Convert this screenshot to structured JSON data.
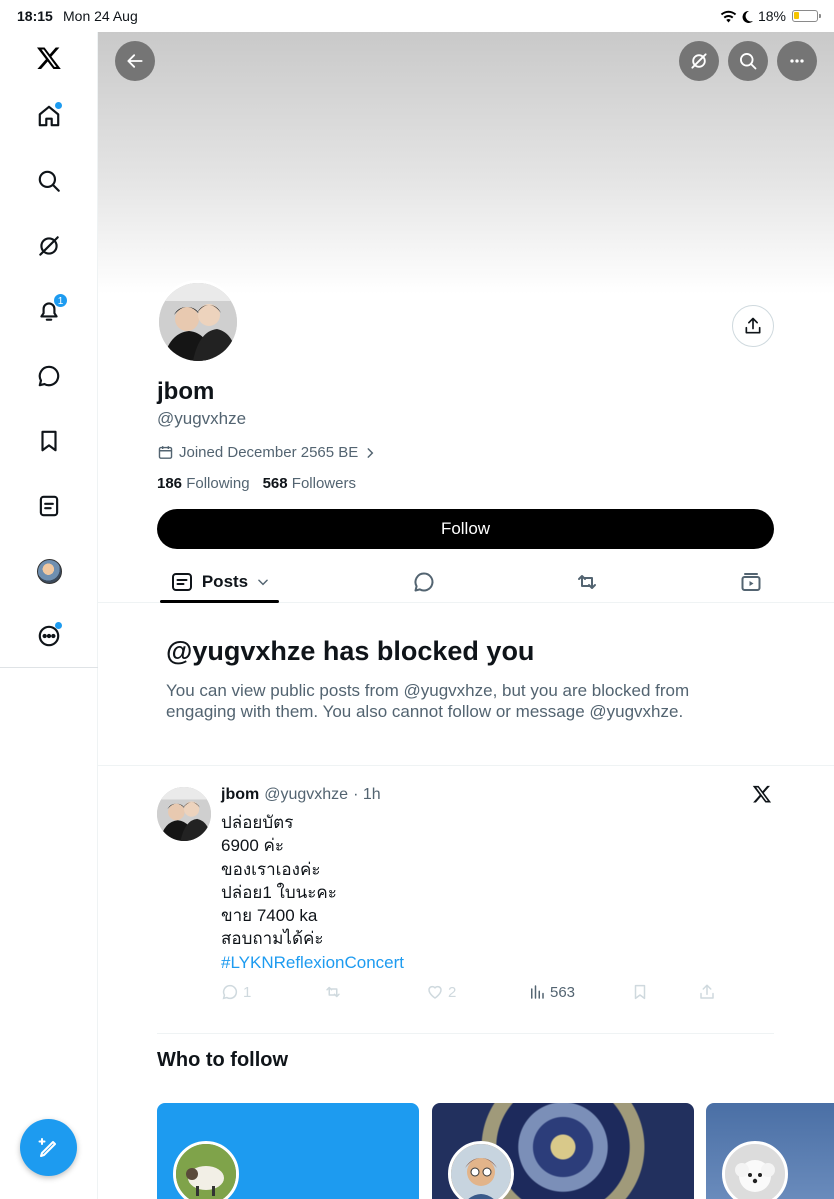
{
  "status_bar": {
    "time": "18:15",
    "date": "Mon 24 Aug",
    "battery": "18%"
  },
  "sidebar": {
    "items": [
      {
        "name": "x-logo"
      },
      {
        "name": "home",
        "dot": true
      },
      {
        "name": "explore"
      },
      {
        "name": "grok"
      },
      {
        "name": "notifications",
        "badge": "1"
      },
      {
        "name": "messages"
      },
      {
        "name": "bookmarks"
      },
      {
        "name": "lists"
      },
      {
        "name": "profile"
      },
      {
        "name": "more",
        "dot": true
      }
    ]
  },
  "profile": {
    "display_name": "jbom",
    "handle": "@yugvxhze",
    "joined": "Joined December 2565 BE",
    "following_count": "186",
    "following_label": "Following",
    "followers_count": "568",
    "followers_label": "Followers",
    "follow_button": "Follow"
  },
  "tabs": {
    "posts_label": "Posts"
  },
  "blocked": {
    "title": "@yugvxhze has blocked you",
    "text": "You can view public posts from @yugvxhze, but you are blocked from engaging with them. You also cannot follow or message @yugvxhze."
  },
  "tweet": {
    "name": "jbom",
    "handle": "@yugvxhze",
    "time": "· 1h",
    "lines": [
      "ปล่อยบัตร",
      "6900 ค่ะ",
      "ของเราเองค่ะ",
      "ปล่อย1 ใบนะคะ",
      "ขาย 7400 ka",
      "สอบถามได้ค่ะ"
    ],
    "hashtag": "#LYKNReflexionConcert",
    "replies": "1",
    "likes": "2",
    "views": "563"
  },
  "who_to_follow": {
    "title": "Who to follow"
  },
  "colors": {
    "accent": "#1d9bf0",
    "text": "#0f1419",
    "secondary": "#536471"
  }
}
